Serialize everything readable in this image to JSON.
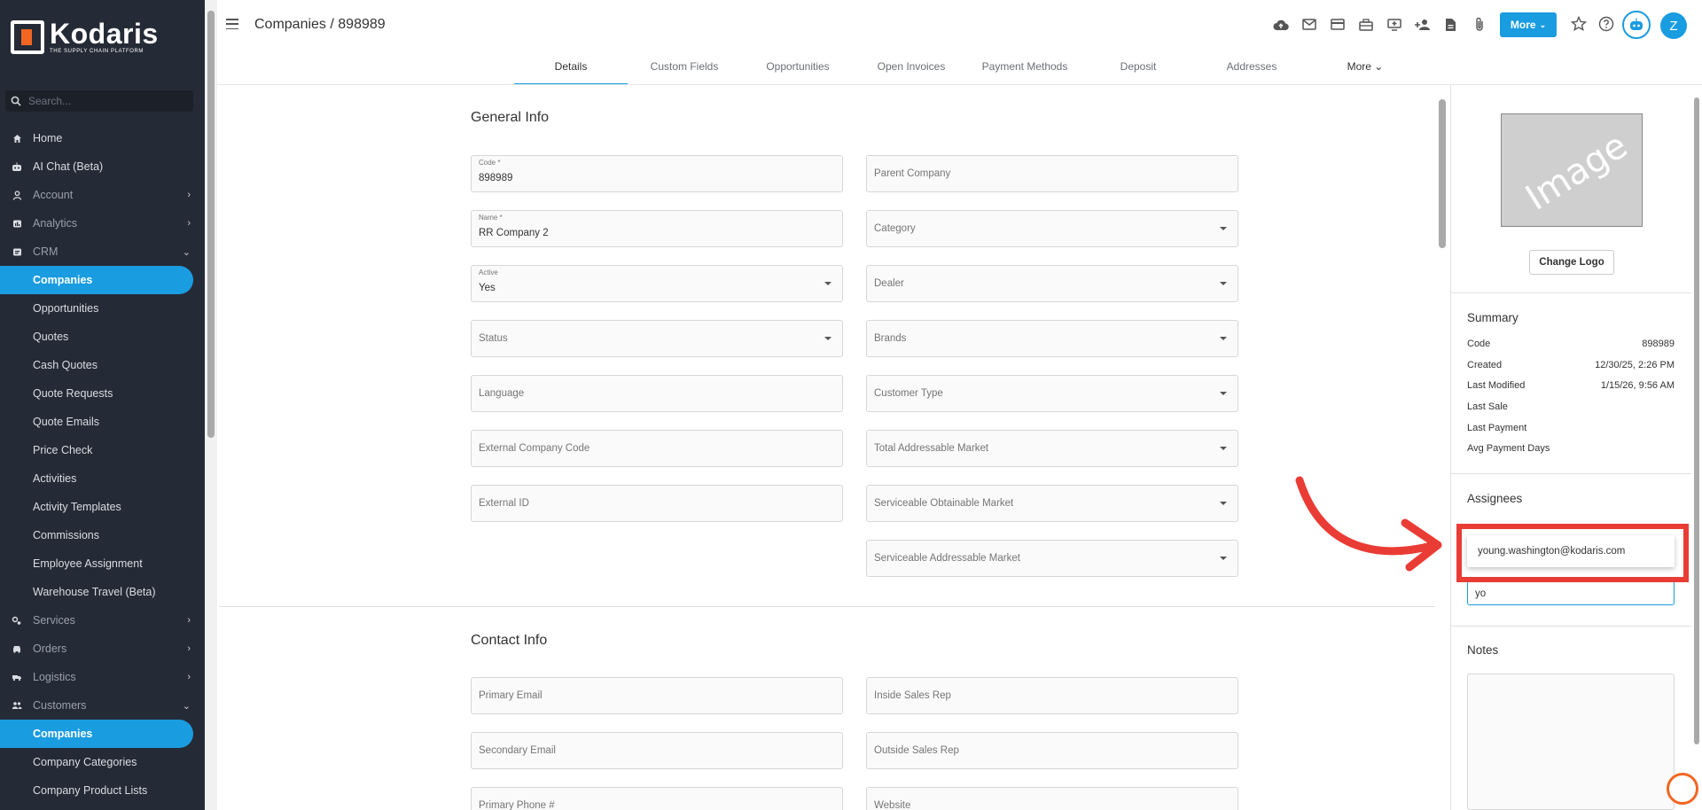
{
  "sidebar": {
    "logo_name": "Kodaris",
    "logo_tagline": "THE SUPPLY CHAIN PLATFORM",
    "search_placeholder": "Search...",
    "items": [
      {
        "label": "Home",
        "icon": "home-icon",
        "chevron": ""
      },
      {
        "label": "AI Chat (Beta)",
        "icon": "robot-icon",
        "chevron": ""
      },
      {
        "label": "Account",
        "icon": "user-icon",
        "chevron": "›"
      },
      {
        "label": "Analytics",
        "icon": "analytics-icon",
        "chevron": "›"
      },
      {
        "label": "CRM",
        "icon": "crm-icon",
        "chevron": "⌄"
      },
      {
        "label": "Companies",
        "sub": true,
        "active": true
      },
      {
        "label": "Opportunities",
        "sub": true
      },
      {
        "label": "Quotes",
        "sub": true
      },
      {
        "label": "Cash Quotes",
        "sub": true
      },
      {
        "label": "Quote Requests",
        "sub": true
      },
      {
        "label": "Quote Emails",
        "sub": true
      },
      {
        "label": "Price Check",
        "sub": true
      },
      {
        "label": "Activities",
        "sub": true
      },
      {
        "label": "Activity Templates",
        "sub": true
      },
      {
        "label": "Commissions",
        "sub": true
      },
      {
        "label": "Employee Assignment",
        "sub": true
      },
      {
        "label": "Warehouse Travel (Beta)",
        "sub": true
      },
      {
        "label": "Services",
        "icon": "services-icon",
        "chevron": "›"
      },
      {
        "label": "Orders",
        "icon": "car-icon",
        "chevron": "›"
      },
      {
        "label": "Logistics",
        "icon": "truck-icon",
        "chevron": "›"
      },
      {
        "label": "Customers",
        "icon": "customers-icon",
        "chevron": "⌄"
      },
      {
        "label": "Companies",
        "sub": true,
        "active": true
      },
      {
        "label": "Company Categories",
        "sub": true
      },
      {
        "label": "Company Product Lists",
        "sub": true
      }
    ]
  },
  "header": {
    "breadcrumb": "Companies / 898989",
    "more_label": "More",
    "avatar_initial": "Z"
  },
  "tabs": [
    {
      "label": "Details",
      "active": true
    },
    {
      "label": "Custom Fields"
    },
    {
      "label": "Opportunities"
    },
    {
      "label": "Open Invoices"
    },
    {
      "label": "Payment Methods"
    },
    {
      "label": "Deposit"
    },
    {
      "label": "Addresses"
    },
    {
      "label": "More ⌄"
    }
  ],
  "general_info": {
    "title": "General Info",
    "code_label": "Code *",
    "code_value": "898989",
    "parent_company_placeholder": "Parent Company",
    "name_label": "Name *",
    "name_value": "RR Company 2",
    "category_placeholder": "Category",
    "active_label": "Active",
    "active_value": "Yes",
    "dealer_placeholder": "Dealer",
    "status_placeholder": "Status",
    "brands_placeholder": "Brands",
    "language_placeholder": "Language",
    "customer_type_placeholder": "Customer Type",
    "external_company_code_placeholder": "External Company Code",
    "tam_placeholder": "Total Addressable Market",
    "external_id_placeholder": "External ID",
    "som_placeholder": "Serviceable Obtainable Market",
    "sam_placeholder": "Serviceable Addressable Market"
  },
  "contact_info": {
    "title": "Contact Info",
    "primary_email_placeholder": "Primary Email",
    "inside_sales_rep_placeholder": "Inside Sales Rep",
    "secondary_email_placeholder": "Secondary Email",
    "outside_sales_rep_placeholder": "Outside Sales Rep",
    "primary_phone_placeholder": "Primary Phone #",
    "website_placeholder": "Website"
  },
  "right_panel": {
    "image_placeholder": "Image",
    "change_logo_label": "Change Logo",
    "summary_title": "Summary",
    "summary": [
      {
        "label": "Code",
        "value": "898989"
      },
      {
        "label": "Created",
        "value": "12/30/25, 2:26 PM"
      },
      {
        "label": "Last Modified",
        "value": "1/15/26, 9:56 AM"
      },
      {
        "label": "Last Sale",
        "value": ""
      },
      {
        "label": "Last Payment",
        "value": ""
      },
      {
        "label": "Avg Payment Days",
        "value": ""
      }
    ],
    "assignees_title": "Assignees",
    "assignee_suggestion": "young.washington@kodaris.com",
    "assignee_input": "yo",
    "notes_title": "Notes"
  },
  "colors": {
    "accent": "#1a9ce0",
    "sidebar_bg": "#252b36",
    "highlight": "#e93c35",
    "logo_orange": "#f26522"
  }
}
